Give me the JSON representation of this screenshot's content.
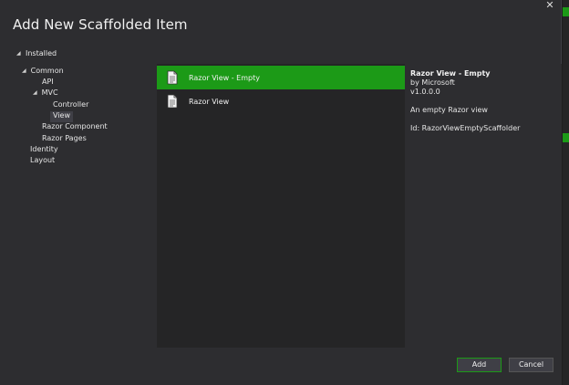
{
  "dialog": {
    "title": "Add New Scaffolded Item",
    "close_glyph": "✕"
  },
  "tree": {
    "root_label": "Installed",
    "items": [
      {
        "label": "Common",
        "expanded": true
      },
      {
        "label": "API"
      },
      {
        "label": "MVC",
        "expanded": true
      },
      {
        "label": "Controller"
      },
      {
        "label": "View",
        "selected": true
      },
      {
        "label": "Razor Component"
      },
      {
        "label": "Razor Pages"
      },
      {
        "label": "Identity"
      },
      {
        "label": "Layout"
      }
    ]
  },
  "list": {
    "items": [
      {
        "label": "Razor View - Empty",
        "icon": "document-icon",
        "selected": true
      },
      {
        "label": "Razor View",
        "icon": "document-icon"
      }
    ]
  },
  "details": {
    "title": "Razor View - Empty",
    "author": "by Microsoft",
    "version": "v1.0.0.0",
    "description": "An empty Razor view",
    "id": "Id: RazorViewEmptyScaffolder"
  },
  "footer": {
    "add_label": "Add",
    "cancel_label": "Cancel"
  },
  "colors": {
    "accent": "#1c9a17",
    "background": "#2d2d30",
    "list_background": "#252526"
  }
}
